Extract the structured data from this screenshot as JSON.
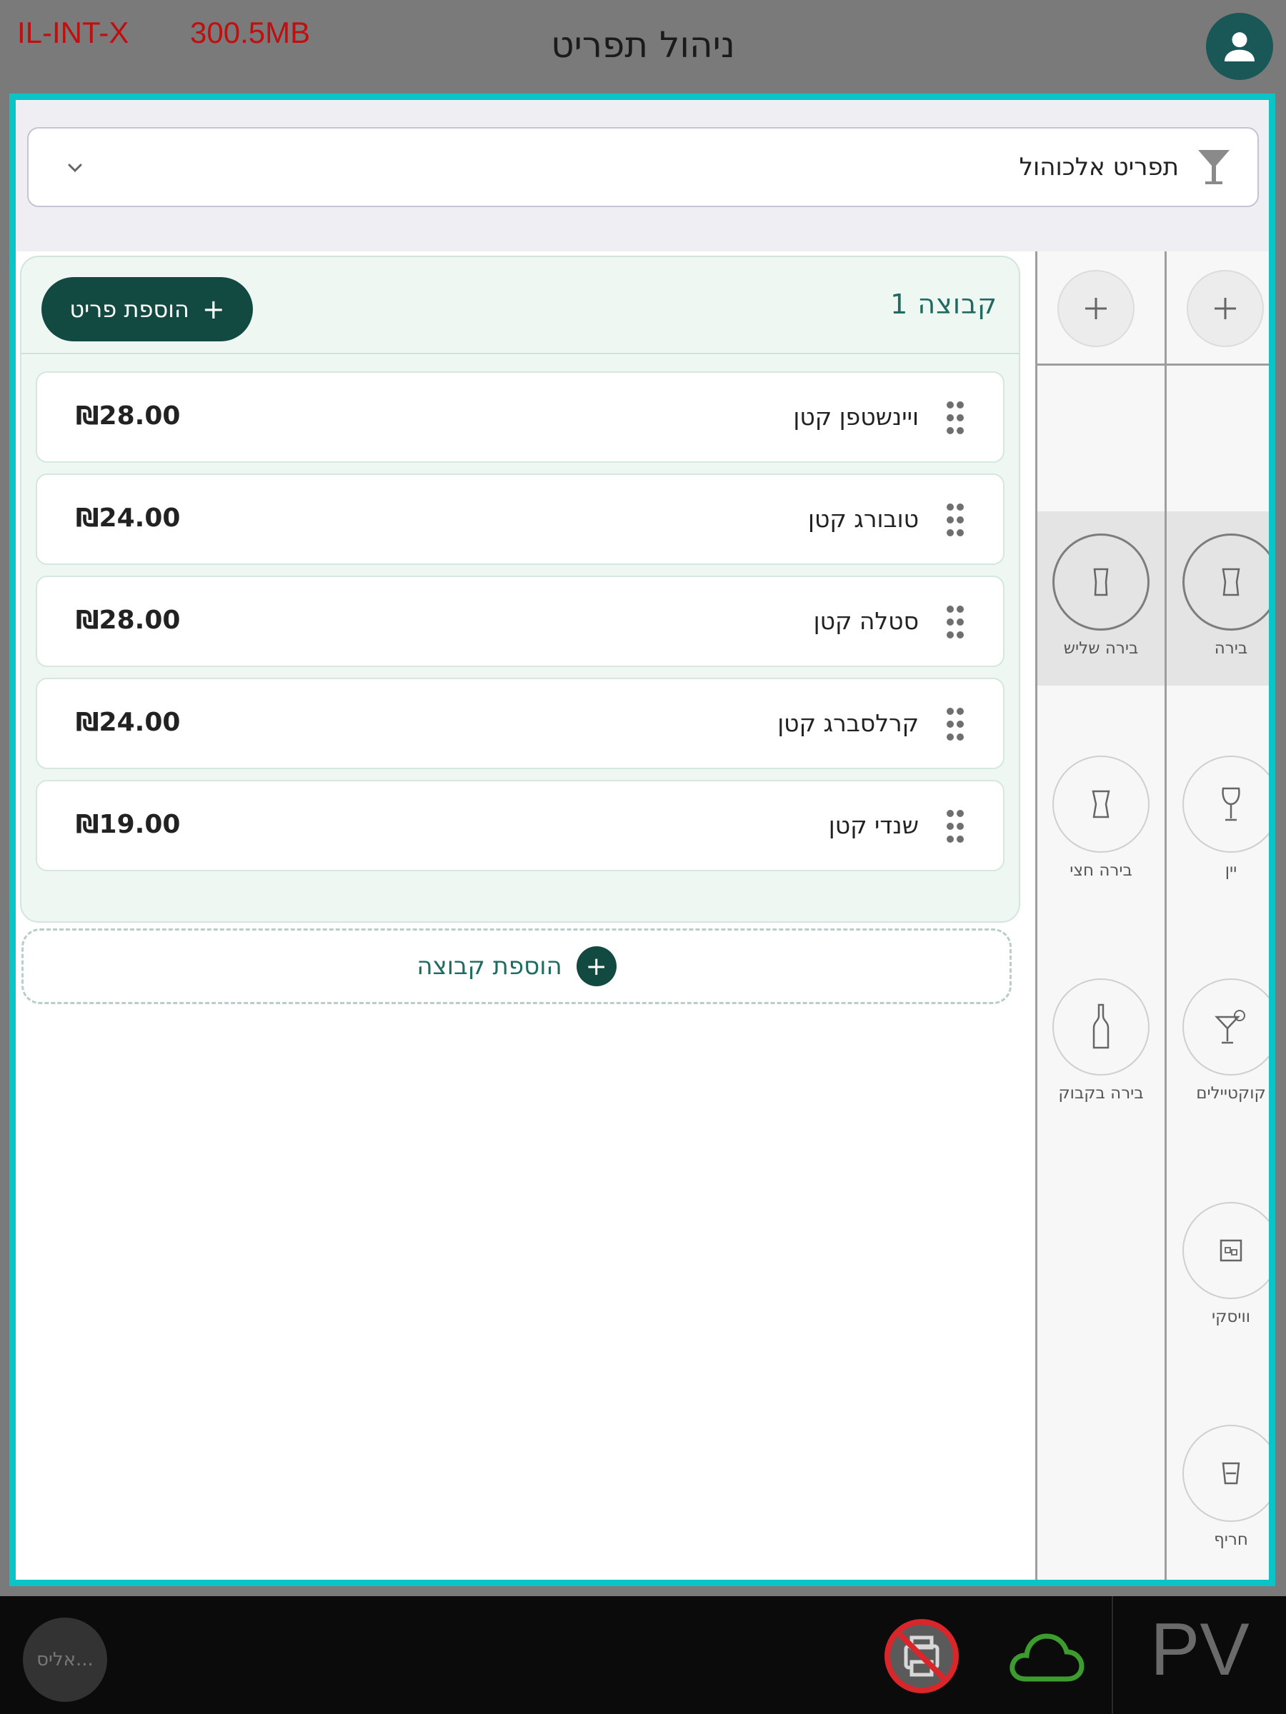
{
  "header": {
    "build_label": "IL-INT-X",
    "memory_label": "300.5MB",
    "title": "ניהול תפריט",
    "avatar_icon": "user-icon"
  },
  "menu_select": {
    "icon": "cocktail-glass-icon",
    "value": "תפריט אלכוהול",
    "chevron_icon": "chevron-down-icon"
  },
  "group": {
    "title": "קבוצה 1",
    "add_item_label": "הוספת פריט",
    "items": [
      {
        "name": "ויינשטפן קטן",
        "price": "₪28.00"
      },
      {
        "name": "טובורג קטן",
        "price": "₪24.00"
      },
      {
        "name": "סטלה קטן",
        "price": "₪28.00"
      },
      {
        "name": "קרלסברג קטן",
        "price": "₪24.00"
      },
      {
        "name": "שנדי קטן",
        "price": "₪19.00"
      }
    ]
  },
  "add_group_label": "הוספת קבוצה",
  "categories_right": [
    {
      "label": "בירה",
      "icon": "beer-glass-icon",
      "selected": true
    },
    {
      "label": "יין",
      "icon": "wine-glass-icon",
      "selected": false
    },
    {
      "label": "קוקטיילים",
      "icon": "cocktail-icon",
      "selected": false
    },
    {
      "label": "וויסקי",
      "icon": "whiskey-glass-icon",
      "selected": false
    },
    {
      "label": "חריף",
      "icon": "shot-glass-icon",
      "selected": false
    }
  ],
  "categories_mid": [
    {
      "label": "בירה שליש",
      "icon": "beer-glass-icon",
      "selected": true
    },
    {
      "label": "בירה חצי",
      "icon": "beer-glass-icon",
      "selected": false
    },
    {
      "label": "בירה בקבוק",
      "icon": "beer-bottle-icon",
      "selected": false
    }
  ],
  "bottom_bar": {
    "user_chip": "אליס...",
    "printer_status_icon": "printer-disabled-icon",
    "cloud_icon": "cloud-icon",
    "brand": "PV"
  },
  "colors": {
    "accent": "#0bc4c8",
    "primary": "#124a42",
    "group_bg": "#eef7f2",
    "warning_text": "#c00f0f"
  }
}
